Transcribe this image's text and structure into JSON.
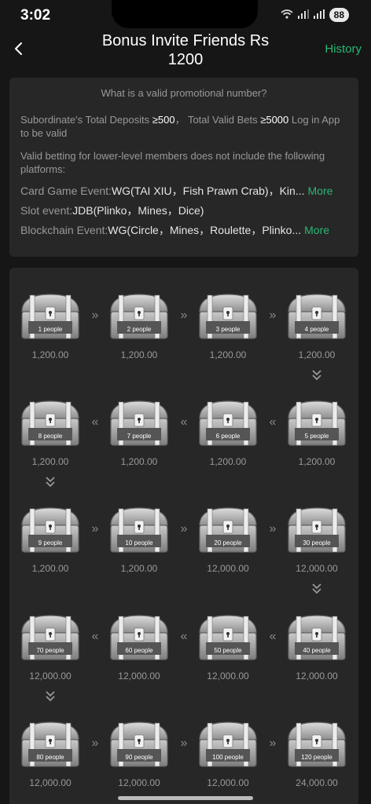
{
  "status": {
    "time": "3:02",
    "battery": "88"
  },
  "header": {
    "title": "Bonus Invite Friends Rs 1200",
    "history": "History"
  },
  "info": {
    "question": "What is a valid promotional number?",
    "rule_prefix": "Subordinate's Total Deposits ",
    "rule_deposit": "≥500",
    "rule_mid": "， Total Valid Bets ",
    "rule_bets": "≥5000",
    "rule_suffix": " Log in App to be valid",
    "note": "Valid betting for lower-level members does not include the following platforms:",
    "platforms": [
      {
        "label": "Card Game Event: ",
        "value": "WG(TAI XIU，Fish Prawn Crab)，Kin...",
        "more": "More"
      },
      {
        "label": "Slot event: ",
        "value": "JDB(Plinko，Mines，Dice)",
        "more": ""
      },
      {
        "label": "Blockchain Event: ",
        "value": "WG(Circle，Mines，Roulette，Plinko...",
        "more": "More"
      }
    ]
  },
  "chests": [
    {
      "label": "1 people",
      "amount": "1,200.00"
    },
    {
      "label": "2 people",
      "amount": "1,200.00"
    },
    {
      "label": "3 people",
      "amount": "1,200.00"
    },
    {
      "label": "4 people",
      "amount": "1,200.00"
    },
    {
      "label": "5 people",
      "amount": "1,200.00"
    },
    {
      "label": "6 people",
      "amount": "1,200.00"
    },
    {
      "label": "7 people",
      "amount": "1,200.00"
    },
    {
      "label": "8 people",
      "amount": "1,200.00"
    },
    {
      "label": "9 people",
      "amount": "1,200.00"
    },
    {
      "label": "10 people",
      "amount": "1,200.00"
    },
    {
      "label": "20 people",
      "amount": "12,000.00"
    },
    {
      "label": "30 people",
      "amount": "12,000.00"
    },
    {
      "label": "40 people",
      "amount": "12,000.00"
    },
    {
      "label": "50 people",
      "amount": "12,000.00"
    },
    {
      "label": "60 people",
      "amount": "12,000.00"
    },
    {
      "label": "70 people",
      "amount": "12,000.00"
    },
    {
      "label": "80 people",
      "amount": "12,000.00"
    },
    {
      "label": "90 people",
      "amount": "12,000.00"
    },
    {
      "label": "100 people",
      "amount": "12,000.00"
    },
    {
      "label": "120 people",
      "amount": "24,000.00"
    }
  ],
  "arrows": {
    "right": "»",
    "left": "«",
    "down": "⌄"
  },
  "colors": {
    "accent": "#2bb673",
    "background": "#161616",
    "card": "#272727"
  },
  "icons": [
    "back-arrow-icon",
    "wifi-icon",
    "signal-icon",
    "battery-icon",
    "treasure-chest-icon",
    "lock-icon"
  ]
}
